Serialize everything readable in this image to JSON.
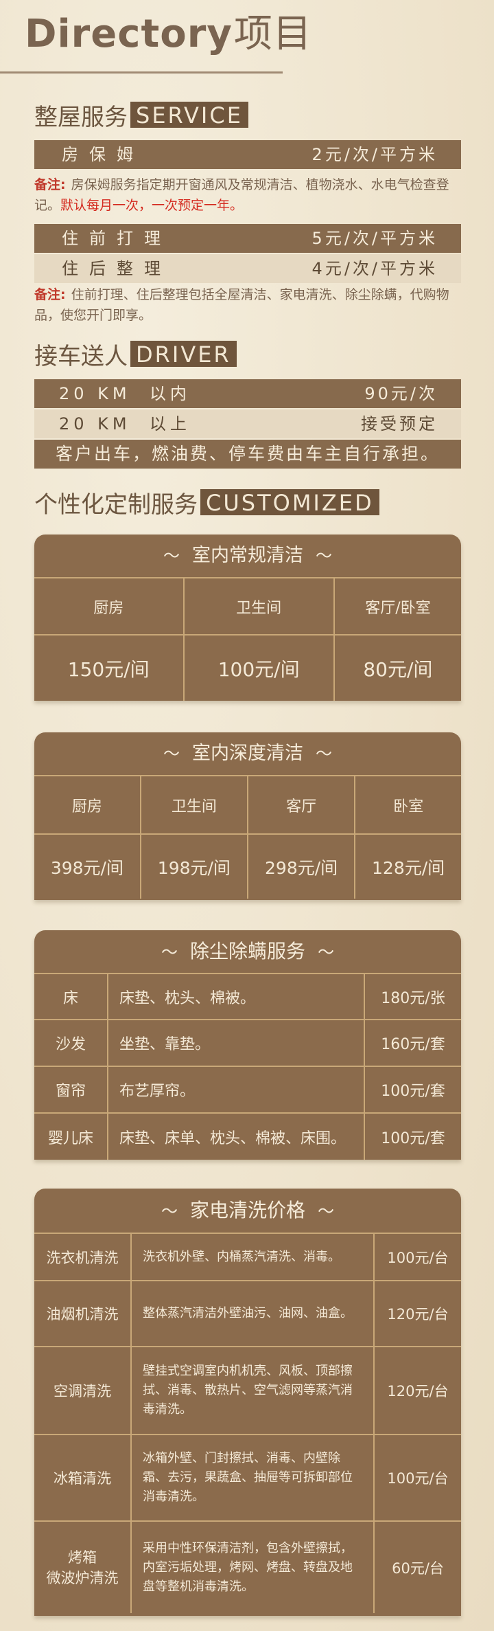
{
  "header": {
    "title_en": "Directory",
    "title_cn": "项目"
  },
  "service": {
    "title": "整屋服务",
    "tag": "SERVICE",
    "nanny": {
      "label": "房保姆",
      "price": "2元/次/平方米"
    },
    "note1": {
      "label": "备注:",
      "text": "房保姆服务指定期开窗通风及常规清洁、植物浇水、水电气检查登记。",
      "red": "默认每月一次，一次预定一年。"
    },
    "pre": {
      "label": "住前打理",
      "price": "5元/次/平方米"
    },
    "post": {
      "label": "住后整理",
      "price": "4元/次/平方米"
    },
    "note2": {
      "label": "备注:",
      "text": "住前打理、住后整理包括全屋清洁、家电清洗、除尘除螨，代购物品，使您开门即享。"
    }
  },
  "driver": {
    "title": "接车送人",
    "tag": "DRIVER",
    "row1": {
      "label": "20 KM  以内",
      "price": "90元/次"
    },
    "row2": {
      "label": "20 KM  以上",
      "price": "接受预定"
    },
    "row3": "客户出车，燃油费、停车费由车主自行承担。"
  },
  "customized": {
    "title": "个性化定制服务",
    "tag": "CUSTOMIZED"
  },
  "regular": {
    "title": "室内常规清洁",
    "headers": [
      "厨房",
      "卫生间",
      "客厅/卧室"
    ],
    "prices": [
      "150元/间",
      "100元/间",
      "80元/间"
    ]
  },
  "deep": {
    "title": "室内深度清洁",
    "headers": [
      "厨房",
      "卫生间",
      "客厅",
      "卧室"
    ],
    "prices": [
      "398元/间",
      "198元/间",
      "298元/间",
      "128元/间"
    ]
  },
  "mite": {
    "title": "除尘除螨服务",
    "rows": [
      {
        "name": "床",
        "desc": "床垫、枕头、棉被。",
        "price": "180元/张"
      },
      {
        "name": "沙发",
        "desc": "坐垫、靠垫。",
        "price": "160元/套"
      },
      {
        "name": "窗帘",
        "desc": "布艺厚帘。",
        "price": "100元/套"
      },
      {
        "name": "婴儿床",
        "desc": "床垫、床单、枕头、棉被、床围。",
        "price": "100元/套"
      }
    ]
  },
  "appliance": {
    "title": "家电清洗价格",
    "rows": [
      {
        "name": "洗衣机清洗",
        "desc": "洗衣机外壁、内桶蒸汽清洗、消毒。",
        "price": "100元/台"
      },
      {
        "name": "油烟机清洗",
        "desc": "整体蒸汽清洁外壁油污、油网、油盒。",
        "price": "120元/台"
      },
      {
        "name": "空调清洗",
        "desc": "壁挂式空调室内机机壳、风板、顶部擦拭、消毒、散热片、空气滤网等蒸汽消毒清洗。",
        "price": "120元/台"
      },
      {
        "name": "冰箱清洗",
        "desc": "冰箱外壁、门封擦拭、消毒、内壁除霜、去污，果蔬盒、抽屉等可拆卸部位消毒清洗。",
        "price": "100元/台"
      },
      {
        "name": "烤箱\n微波炉清洗",
        "desc": "采用中性环保清洁剂，包含外壁擦拭，内室污垢处理，烤网、烤盘、转盘及地盘等整机消毒清洗。",
        "price": "60元/台"
      }
    ]
  },
  "colors": {
    "brown": "#876a4d",
    "card": "#8b6b4c",
    "light": "#e6d9c2",
    "red": "#d42a1f",
    "gold": "#c9a878"
  }
}
